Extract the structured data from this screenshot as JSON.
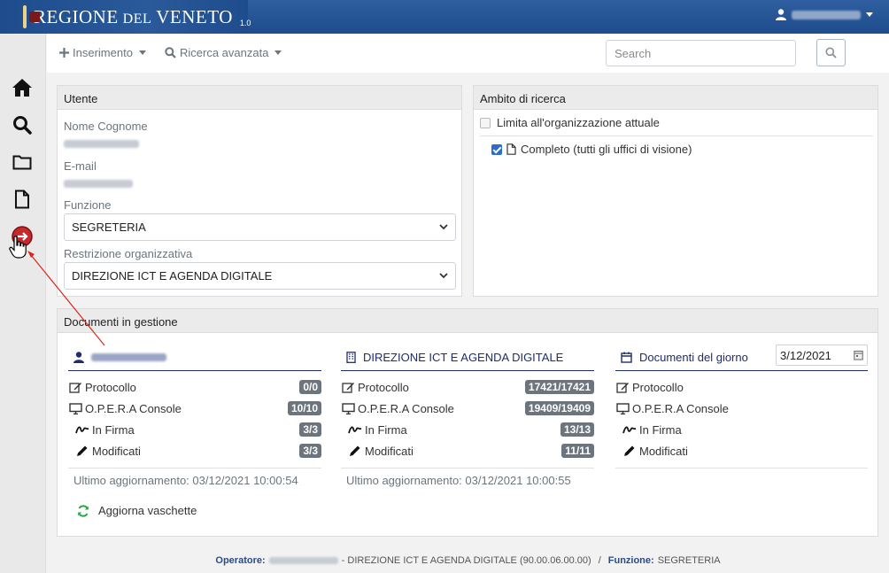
{
  "header": {
    "brand_main": "REGIONE",
    "brand_small": "DEL",
    "brand_end": "VENETO",
    "version": "1.0",
    "user_icon": "user-icon"
  },
  "sidebar": {
    "items": [
      {
        "name": "home",
        "icon": "home-icon"
      },
      {
        "name": "search",
        "icon": "search-icon"
      },
      {
        "name": "folder",
        "icon": "folder-icon"
      },
      {
        "name": "document",
        "icon": "file-icon"
      },
      {
        "name": "exit",
        "icon": "logout-icon"
      }
    ]
  },
  "toolbar": {
    "insert_label": "Inserimento",
    "advanced_search_label": "Ricerca avanzata",
    "search_placeholder": "Search"
  },
  "utente": {
    "title": "Utente",
    "name_label": "Nome Cognome",
    "email_label": "E-mail",
    "funzione_label": "Funzione",
    "funzione_value": "SEGRETERIA",
    "restrizione_label": "Restrizione organizzativa",
    "restrizione_value": "DIREZIONE ICT E AGENDA DIGITALE"
  },
  "ambito": {
    "title": "Ambito di ricerca",
    "limita_label": "Limita all'organizzazione attuale",
    "limita_checked": false,
    "completo_label": "Completo (tutti gli uffici di visione)",
    "completo_checked": true
  },
  "documenti": {
    "title": "Documenti in gestione",
    "columns": [
      {
        "heading": "",
        "rows": [
          {
            "label": "Protocollo",
            "badge": "0/0"
          },
          {
            "label": "O.P.E.R.A Console",
            "badge": "10/10"
          },
          {
            "label": "In Firma",
            "badge": "3/3"
          },
          {
            "label": "Modificati",
            "badge": "3/3"
          }
        ],
        "updated": "Ultimo aggiornamento: 03/12/2021 10:00:54",
        "refresh_label": "Aggiorna vaschette"
      },
      {
        "heading": "DIREZIONE ICT E AGENDA DIGITALE",
        "rows": [
          {
            "label": "Protocollo",
            "badge": "17421/17421"
          },
          {
            "label": "O.P.E.R.A Console",
            "badge": "19409/19409"
          },
          {
            "label": "In Firma",
            "badge": "13/13"
          },
          {
            "label": "Modificati",
            "badge": "11/11"
          }
        ],
        "updated": "Ultimo aggiornamento: 03/12/2021 10:00:55"
      },
      {
        "heading": "Documenti del giorno",
        "date_value": "3/12/2021",
        "rows": [
          {
            "label": "Protocollo"
          },
          {
            "label": "O.P.E.R.A Console"
          },
          {
            "label": "In Firma"
          },
          {
            "label": "Modificati"
          }
        ]
      }
    ]
  },
  "footer": {
    "operatore_label": "Operatore:",
    "office_text": "- DIREZIONE ICT E AGENDA DIGITALE (90.00.06.00.00)",
    "separator": "/",
    "funzione_label": "Funzione:",
    "funzione_value": "SEGRETERIA"
  },
  "colors": {
    "header_blue": "#1e4c8c",
    "heading_navy": "#1f2d6b",
    "badge_gray": "#6c757d",
    "check_blue": "#2c6ccc",
    "refresh_green": "#28a745",
    "arrow_red": "#d9261c"
  }
}
